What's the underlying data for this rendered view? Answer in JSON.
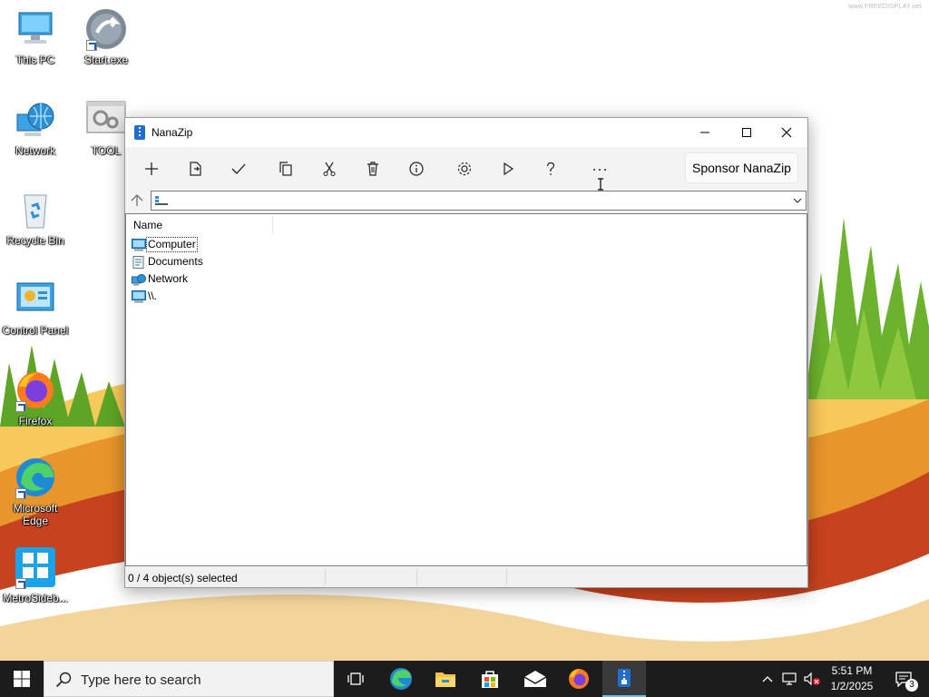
{
  "desktop": {
    "watermark": "www.FREEDISPLAY.net",
    "icons": [
      {
        "label": "This PC"
      },
      {
        "label": "Start.exe"
      },
      {
        "label": "Network"
      },
      {
        "label": "TOOL"
      },
      {
        "label": "Recycle Bin"
      },
      {
        "label": "Control Panel"
      },
      {
        "label": "Firefox"
      },
      {
        "label": "Microsoft Edge"
      },
      {
        "label": "MetroSideb..."
      }
    ]
  },
  "window": {
    "title": "NanaZip",
    "toolbar": {
      "buttons": [
        {
          "name": "add",
          "icon": "plus-icon"
        },
        {
          "name": "extract",
          "icon": "extract-icon"
        },
        {
          "name": "test",
          "icon": "checkmark-icon"
        },
        {
          "name": "copy",
          "icon": "copy-icon"
        },
        {
          "name": "move",
          "icon": "scissors-icon"
        },
        {
          "name": "delete",
          "icon": "trash-icon"
        },
        {
          "name": "info",
          "icon": "info-icon"
        },
        {
          "name": "options",
          "icon": "gear-icon"
        },
        {
          "name": "benchmark",
          "icon": "play-icon"
        },
        {
          "name": "help",
          "icon": "help-icon"
        },
        {
          "name": "more",
          "icon": "more-icon"
        }
      ],
      "sponsor_label": "Sponsor NanaZip"
    },
    "address": {
      "value": ""
    },
    "list": {
      "column_name": "Name",
      "items": [
        {
          "label": "Computer",
          "icon": "computer-icon"
        },
        {
          "label": "Documents",
          "icon": "documents-icon"
        },
        {
          "label": "Network",
          "icon": "network-icon"
        },
        {
          "label": "\\\\.",
          "icon": "computer-icon"
        }
      ]
    },
    "status": {
      "selected": "0 / 4 object(s) selected"
    }
  },
  "taskbar": {
    "search_placeholder": "Type here to search",
    "apps": [
      {
        "name": "Task View"
      },
      {
        "name": "Microsoft Edge"
      },
      {
        "name": "File Explorer"
      },
      {
        "name": "Microsoft Store"
      },
      {
        "name": "Mail"
      },
      {
        "name": "Firefox"
      },
      {
        "name": "NanaZip",
        "active": true
      }
    ],
    "clock": {
      "time": "5:51 PM",
      "date": "1/2/2025"
    },
    "notifications_count": "3"
  }
}
